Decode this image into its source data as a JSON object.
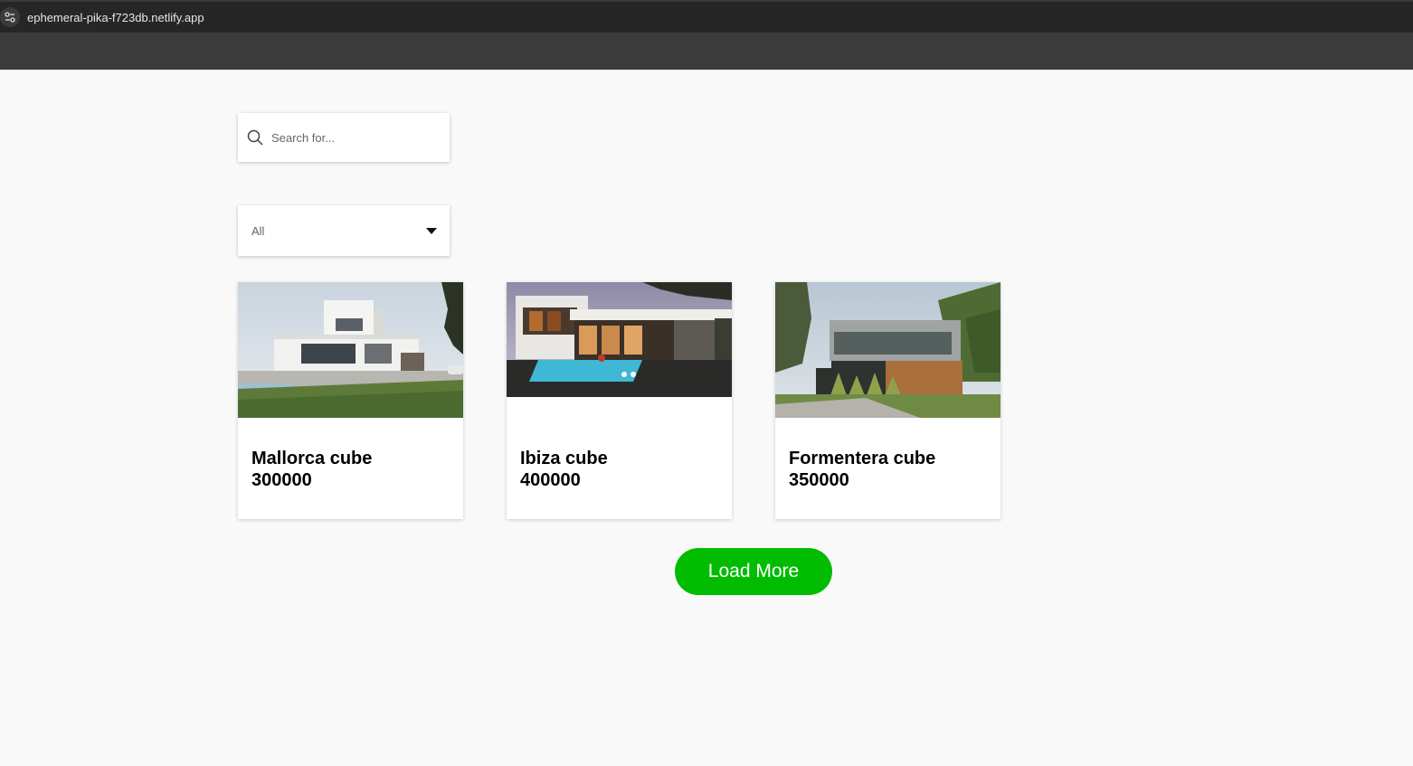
{
  "browser": {
    "url": "ephemeral-pika-f723db.netlify.app"
  },
  "search": {
    "placeholder": "Search for...",
    "value": ""
  },
  "filter": {
    "selected": "All"
  },
  "cards": [
    {
      "title": "Mallorca cube",
      "price": "300000",
      "image": "modern-villa-daytime-photo"
    },
    {
      "title": "Ibiza cube",
      "price": "400000",
      "image": "modern-villa-pool-night-photo"
    },
    {
      "title": "Formentera cube",
      "price": "350000",
      "image": "modern-house-wood-garden-photo"
    }
  ],
  "actions": {
    "load_more_label": "Load More"
  },
  "colors": {
    "accent": "#02bc02",
    "background": "#f9f9f9",
    "browser_chrome": "#262626"
  }
}
